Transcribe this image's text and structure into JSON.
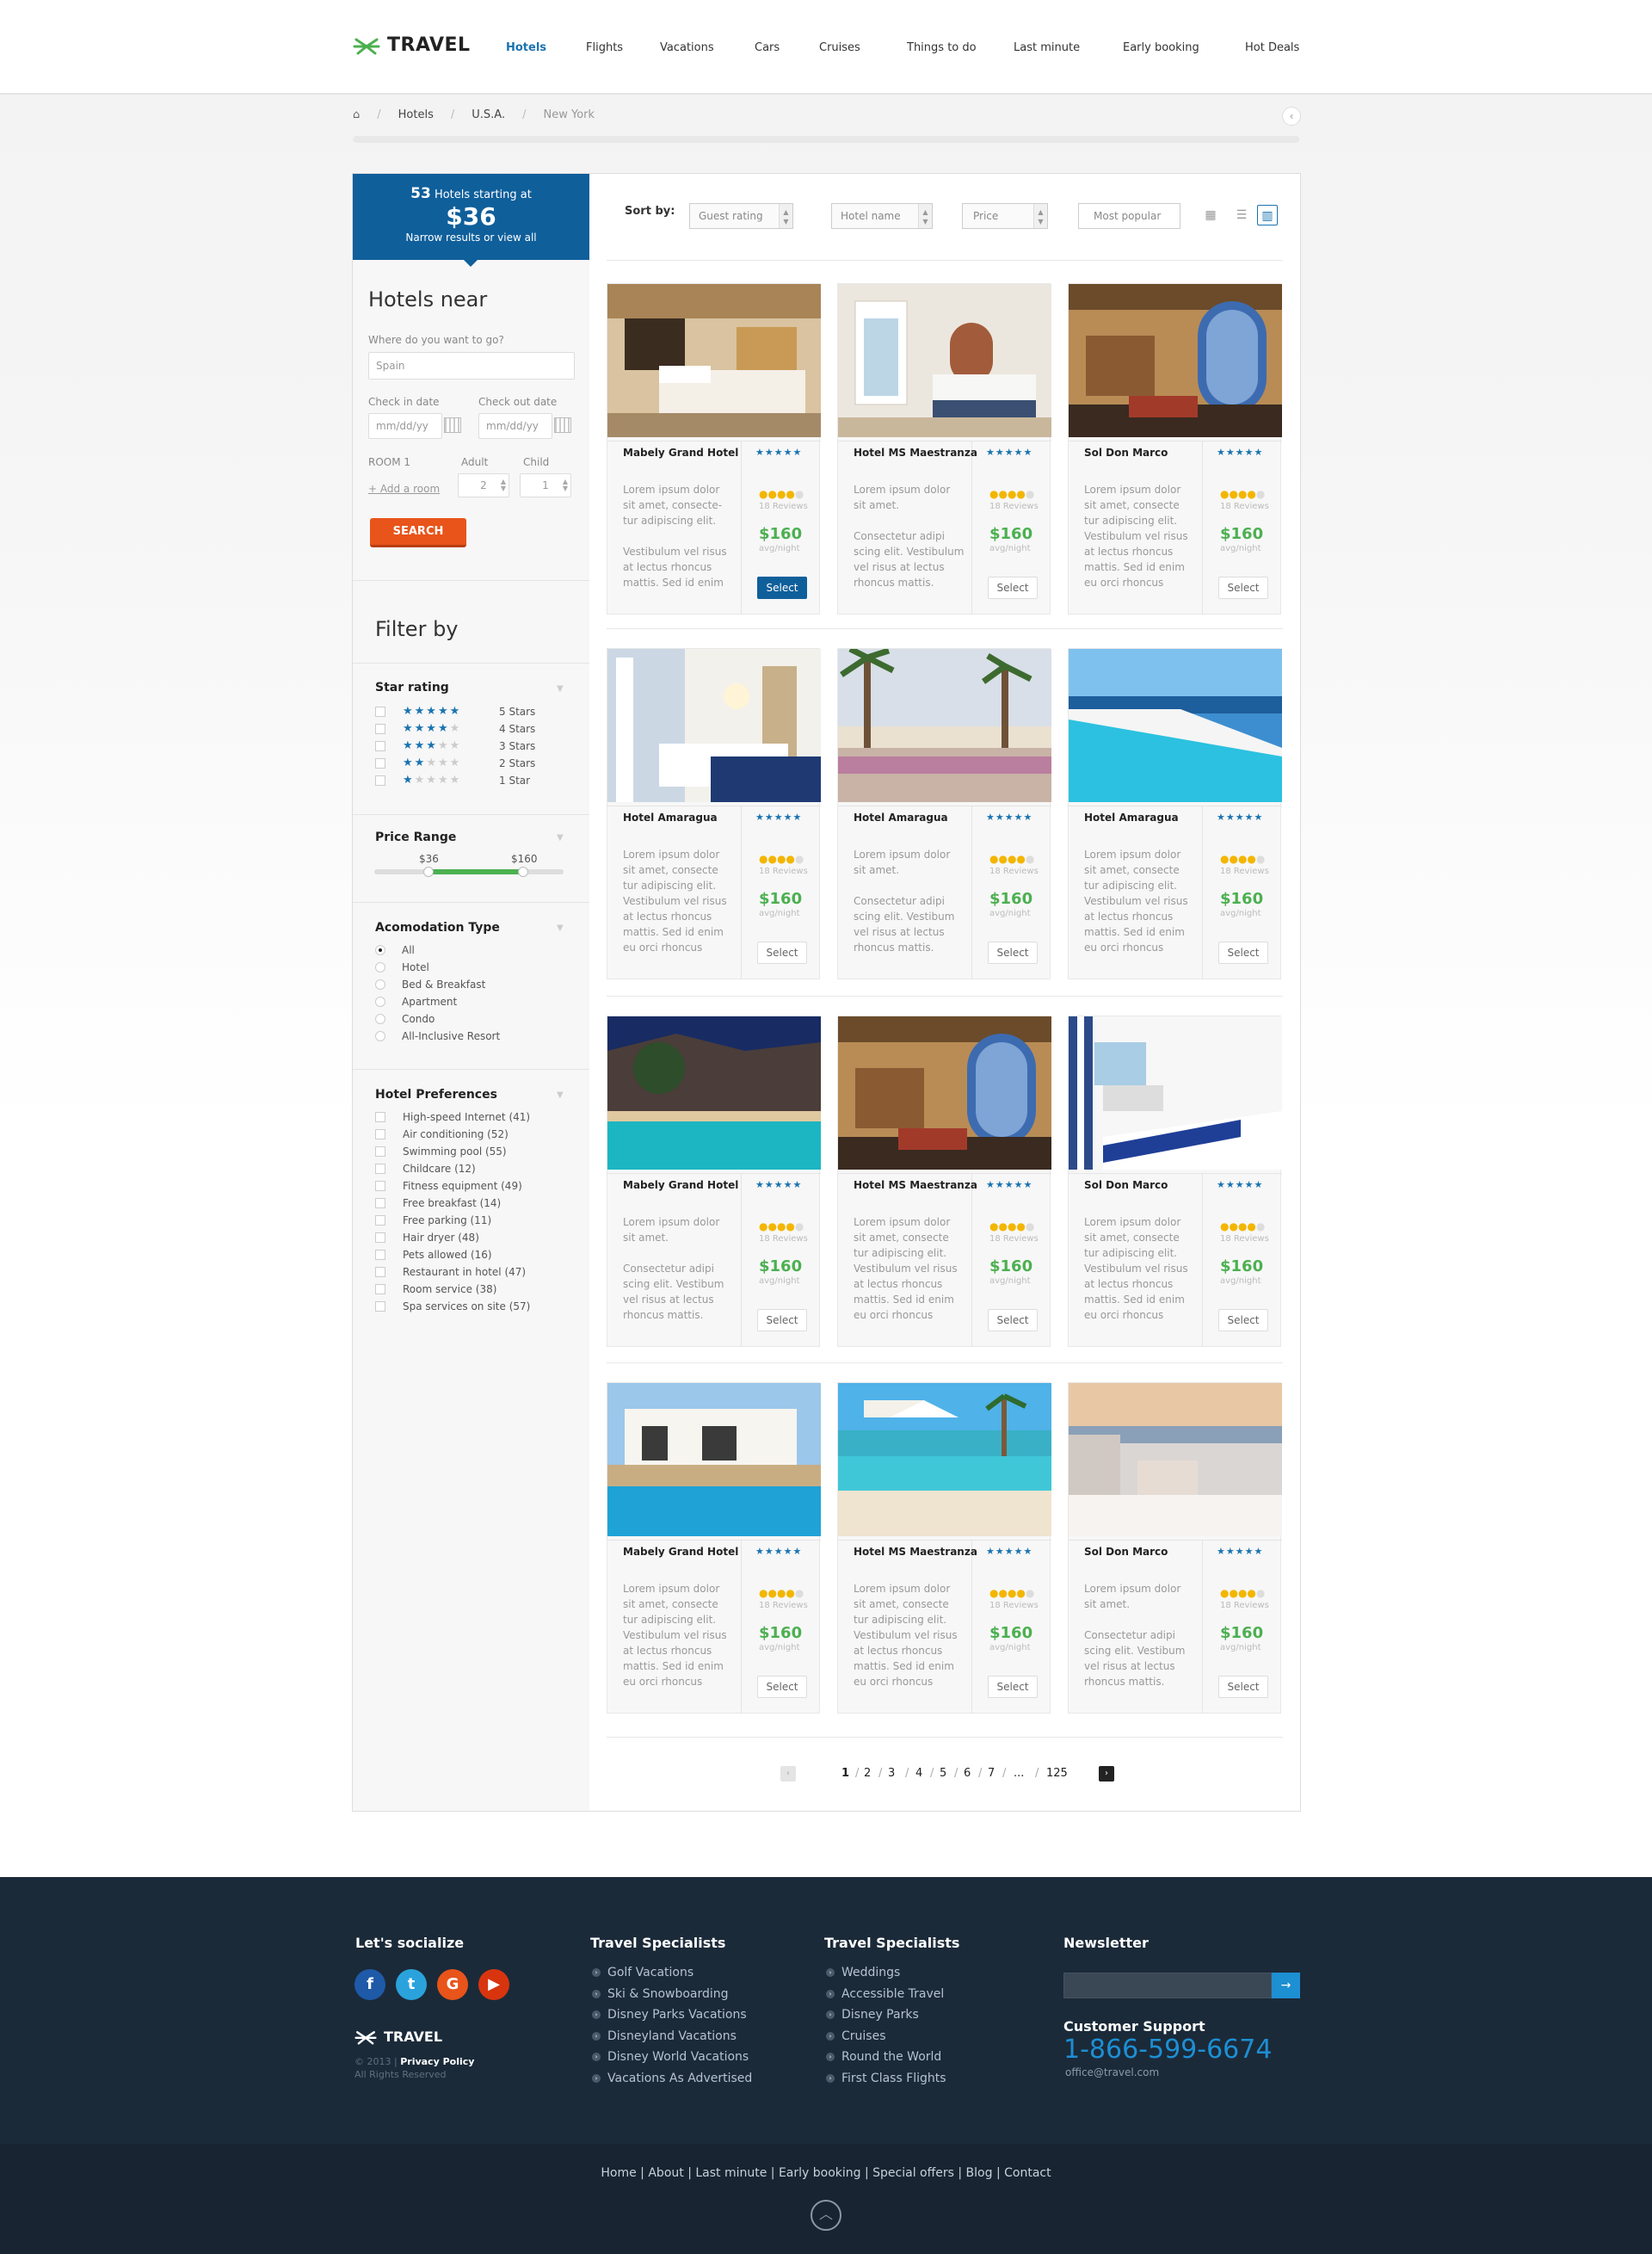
{
  "header": {
    "logo_text": "TRAVEL",
    "nav": [
      {
        "label": "Hotels",
        "active": true
      },
      {
        "label": "Flights"
      },
      {
        "label": "Vacations"
      },
      {
        "label": "Cars"
      },
      {
        "label": "Cruises"
      },
      {
        "label": "Things to do"
      },
      {
        "label": "Last minute"
      },
      {
        "label": "Early booking"
      },
      {
        "label": "Hot Deals"
      }
    ]
  },
  "breadcrumb": {
    "home_icon": "home-icon",
    "items": [
      "Hotels",
      "U.S.A.",
      "New York"
    ],
    "back_icon": "chevron-left-icon"
  },
  "promo": {
    "count": "53",
    "count_suffix": "Hotels starting at",
    "price": "$36",
    "sub": "Narrow results or view all"
  },
  "search": {
    "title": "Hotels near",
    "where_label": "Where do you want to go?",
    "where_value": "Spain",
    "checkin_label": "Check in date",
    "checkout_label": "Check out date",
    "checkin_placeholder": "mm/dd/yy",
    "checkout_placeholder": "mm/dd/yy",
    "room_label": "ROOM 1",
    "add_room": "+ Add a room",
    "adult_label": "Adult",
    "child_label": "Child",
    "adult_value": "2",
    "child_value": "1",
    "button": "SEARCH"
  },
  "filter": {
    "title": "Filter by",
    "star_title": "Star rating",
    "stars": [
      {
        "label": "5 Stars",
        "count": 5
      },
      {
        "label": "4 Stars",
        "count": 4
      },
      {
        "label": "3 Stars",
        "count": 3
      },
      {
        "label": "2 Stars",
        "count": 2
      },
      {
        "label": "1 Star",
        "count": 1
      }
    ],
    "price_title": "Price Range",
    "price_min": "$36",
    "price_max": "$160",
    "acc_title": "Acomodation Type",
    "acc": [
      "All",
      "Hotel",
      "Bed & Breakfast",
      "Apartment",
      "Condo",
      "All-Inclusive Resort"
    ],
    "acc_selected": "All",
    "pref_title": "Hotel Preferences",
    "prefs": [
      "High-speed Internet (41)",
      "Air conditioning (52)",
      "Swimming pool (55)",
      "Childcare (12)",
      "Fitness equipment (49)",
      "Free breakfast (14)",
      "Free parking (11)",
      "Hair dryer (48)",
      "Pets allowed (16)",
      "Restaurant in hotel (47)",
      "Room service (38)",
      "Spa services on site (57)"
    ]
  },
  "sort": {
    "label": "Sort by:",
    "options": [
      "Guest rating",
      "Hotel name",
      "Price",
      "Most popular"
    ],
    "views": [
      "grid-small-icon",
      "list-icon",
      "grid-large-icon"
    ]
  },
  "hotels": [
    {
      "name": "Mabely Grand Hotel",
      "desc": "Lorem ipsum dolor\nsit amet, consecte-\ntur adipiscing elit.\n\nVestibulum vel risus\nat lectus rhoncus\nmattis. Sed id enim",
      "stars": "★★★★★",
      "rating": 4,
      "reviews": "18 Reviews",
      "price": "$160",
      "per": "avg/night",
      "button": "Select",
      "selected": true,
      "scene": "bedroom-warm"
    },
    {
      "name": "Hotel MS Maestranza",
      "desc": "Lorem ipsum dolor\nsit amet.\n\nConsectetur adipi\nscing elit. Vestibulum\nvel risus at lectus\nrhoncus mattis.",
      "stars": "★★★★★",
      "rating": 4,
      "reviews": "18 Reviews",
      "price": "$160",
      "per": "avg/night",
      "button": "Select",
      "scene": "bedroom-bright"
    },
    {
      "name": "Sol Don Marco",
      "desc": "Lorem ipsum dolor\nsit amet, consecte\ntur adipiscing elit.\nVestibulum vel risus\nat lectus rhoncus\nmattis. Sed id enim\neu orci rhoncus",
      "stars": "★★★★★",
      "rating": 4,
      "reviews": "18 Reviews",
      "price": "$160",
      "per": "avg/night",
      "button": "Select",
      "scene": "lobby"
    },
    {
      "name": "Hotel Amaragua",
      "desc": "Lorem ipsum dolor\nsit amet, consecte\ntur adipiscing elit.\nVestibulum vel risus\nat lectus rhoncus\nmattis. Sed id enim\neu orci rhoncus",
      "stars": "★★★★★",
      "rating": 4,
      "reviews": "18 Reviews",
      "price": "$160",
      "per": "avg/night",
      "button": "Select",
      "scene": "white-room"
    },
    {
      "name": "Hotel Amaragua",
      "desc": "Lorem ipsum dolor\nsit amet.\n\nConsectetur adipi\nscing elit. Vestibum\nvel risus at lectus\nrhoncus mattis.",
      "stars": "★★★★★",
      "rating": 4,
      "reviews": "18 Reviews",
      "price": "$160",
      "per": "avg/night",
      "button": "Select",
      "scene": "palms"
    },
    {
      "name": "Hotel Amaragua",
      "desc": "Lorem ipsum dolor\nsit amet, consecte\ntur adipiscing elit.\nVestibulum vel risus\nat lectus rhoncus\nmattis. Sed id enim\neu orci rhoncus",
      "stars": "★★★★★",
      "rating": 4,
      "reviews": "18 Reviews",
      "price": "$160",
      "per": "avg/night",
      "button": "Select",
      "scene": "infinity-pool"
    },
    {
      "name": "Mabely Grand Hotel",
      "desc": "Lorem ipsum dolor\nsit amet.\n\nConsectetur adipi\nscing elit. Vestibum\nvel risus at lectus\nrhoncus mattis.",
      "stars": "★★★★★",
      "rating": 4,
      "reviews": "18 Reviews",
      "price": "$160",
      "per": "avg/night",
      "button": "Select",
      "scene": "night-pool"
    },
    {
      "name": "Hotel MS Maestranza",
      "desc": "Lorem ipsum dolor\nsit amet, consecte\ntur adipiscing elit.\nVestibulum vel risus\nat lectus rhoncus\nmattis. Sed id enim\neu orci rhoncus",
      "stars": "★★★★★",
      "rating": 4,
      "reviews": "18 Reviews",
      "price": "$160",
      "per": "avg/night",
      "button": "Select",
      "scene": "lobby"
    },
    {
      "name": "Sol Don Marco",
      "desc": "Lorem ipsum dolor\nsit amet, consecte\ntur adipiscing elit.\nVestibulum vel risus\nat lectus rhoncus\nmattis. Sed id enim\neu orci rhoncus",
      "stars": "★★★★★",
      "rating": 4,
      "reviews": "18 Reviews",
      "price": "$160",
      "per": "avg/night",
      "button": "Select",
      "scene": "sea-bedroom"
    },
    {
      "name": "Mabely Grand Hotel",
      "desc": "Lorem ipsum dolor\nsit amet, consecte\ntur adipiscing elit.\nVestibulum vel risus\nat lectus rhoncus\nmattis. Sed id enim\neu orci rhoncus",
      "stars": "★★★★★",
      "rating": 4,
      "reviews": "18 Reviews",
      "price": "$160",
      "per": "avg/night",
      "button": "Select",
      "scene": "villa-pool"
    },
    {
      "name": "Hotel MS Maestranza",
      "desc": "Lorem ipsum dolor\nsit amet, consecte\ntur adipiscing elit.\nVestibulum vel risus\nat lectus rhoncus\nmattis. Sed id enim\neu orci rhoncus",
      "stars": "★★★★★",
      "rating": 4,
      "reviews": "18 Reviews",
      "price": "$160",
      "per": "avg/night",
      "button": "Select",
      "scene": "beach-pool"
    },
    {
      "name": "Sol Don Marco",
      "desc": "Lorem ipsum dolor\nsit amet.\n\nConsectetur adipi\nscing elit. Vestibum\nvel risus at lectus\nrhoncus mattis.",
      "stars": "★★★★★",
      "rating": 4,
      "reviews": "18 Reviews",
      "price": "$160",
      "per": "avg/night",
      "button": "Select",
      "scene": "terrace"
    }
  ],
  "pagination": {
    "pages": [
      "1",
      "2",
      "3",
      "4",
      "5",
      "6",
      "7",
      "...",
      "125"
    ],
    "current": "1",
    "prev_icon": "chevron-left-icon",
    "next_icon": "chevron-right-icon"
  },
  "footer": {
    "social_title": "Let's socialize",
    "social": [
      {
        "icon": "facebook-icon",
        "glyph": "f",
        "color": "#1e5aa8"
      },
      {
        "icon": "twitter-icon",
        "glyph": "t",
        "color": "#2aa3dc"
      },
      {
        "icon": "google-plus-icon",
        "glyph": "G",
        "color": "#e8541a"
      },
      {
        "icon": "youtube-icon",
        "glyph": "▶",
        "color": "#d8350f"
      }
    ],
    "logo_text": "TRAVEL",
    "copyright": "© 2013 |",
    "privacy": "Privacy Policy",
    "rights": "All Rights Reserved",
    "col1_title": "Travel Specialists",
    "col1": [
      "Golf Vacations",
      "Ski & Snowboarding",
      "Disney Parks Vacations",
      "Disneyland Vacations",
      "Disney World Vacations",
      "Vacations As Advertised"
    ],
    "col2_title": "Travel Specialists",
    "col2": [
      "Weddings",
      "Accessible Travel",
      "Disney Parks",
      "Cruises",
      "Round the World",
      "First Class Flights"
    ],
    "newsletter_title": "Newsletter",
    "newsletter_button_icon": "arrow-right-icon",
    "support_title": "Customer Support",
    "phone": "1-866-599-6674",
    "email": "office@travel.com",
    "bottom_nav": "Home | About | Last minute | Early booking | Special offers | Blog | Contact",
    "top_icon": "chevron-up-icon"
  },
  "colors": {
    "brand_blue": "#0f5f9b",
    "accent_orange": "#e8541a",
    "price_green": "#4cb050",
    "footer_bg": "#1b2a39"
  }
}
